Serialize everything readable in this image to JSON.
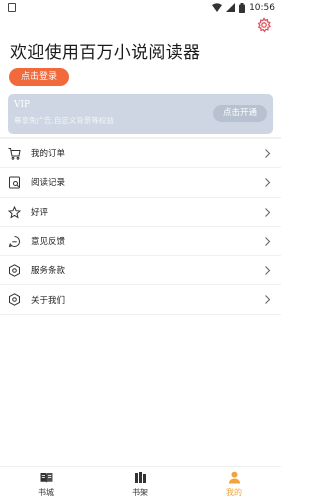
{
  "status_bar": {
    "time": "10:56"
  },
  "header": {
    "title": "欢迎使用百万小说阅读器",
    "login_label": "点击登录"
  },
  "vip": {
    "title": "VIP",
    "description": "尊享免广告,自定义背景等权益",
    "button_label": "点击开通"
  },
  "menu": {
    "items": [
      {
        "label": "我的订单",
        "icon": "cart-icon"
      },
      {
        "label": "阅读记录",
        "icon": "history-icon"
      },
      {
        "label": "好评",
        "icon": "star-icon"
      },
      {
        "label": "意见反馈",
        "icon": "feedback-icon"
      },
      {
        "label": "服务条款",
        "icon": "terms-icon"
      },
      {
        "label": "关于我们",
        "icon": "about-icon"
      }
    ]
  },
  "bottom_nav": {
    "items": [
      {
        "label": "书城",
        "icon": "book-icon",
        "active": false
      },
      {
        "label": "书架",
        "icon": "bookshelf-icon",
        "active": false
      },
      {
        "label": "我的",
        "icon": "profile-icon",
        "active": true
      }
    ]
  },
  "colors": {
    "accent": "#f26a3c",
    "active_tab": "#f2a33b",
    "vip_card": "#cdd6e2",
    "settings_icon": "#e0545d"
  }
}
